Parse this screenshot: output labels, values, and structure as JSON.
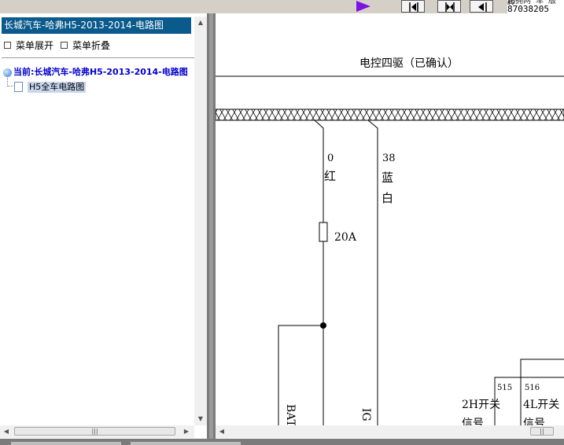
{
  "toolbar": {
    "play_icon": "play-icon",
    "buttons": [
      "first-page-icon",
      "prev-page-icon",
      "back-icon"
    ],
    "info_number": "87038205",
    "info_cut_text": "起拥网 车  版权"
  },
  "left_panel": {
    "title": "长城汽车-哈弗H5-2013-2014-电路图",
    "menu_expand": "菜单展开",
    "menu_collapse": "菜单折叠",
    "tree_root": "当前:长城汽车-哈弗H5-2013-2014-电路图",
    "tree_child": "H5全车电路图"
  },
  "diagram": {
    "title": "电控四驱（已确认）",
    "wire1_num": "0",
    "wire1_color": "红",
    "wire2_num": "38",
    "wire2_color1": "蓝",
    "wire2_color2": "白",
    "fuse_label": "20A",
    "label_batt": "BATT",
    "label_ig": "IG",
    "pin1": "515",
    "pin2": "516",
    "switch1_line1": "2H开关",
    "switch1_line2": "信号",
    "switch2_line1": "4L开关",
    "switch2_line2": "信号"
  },
  "colors": {
    "title_bar": "#0a5a8c",
    "play_icon": "#7b12e6",
    "tree_root_text": "#0000cc",
    "selected_item": "#c9d7ee"
  }
}
